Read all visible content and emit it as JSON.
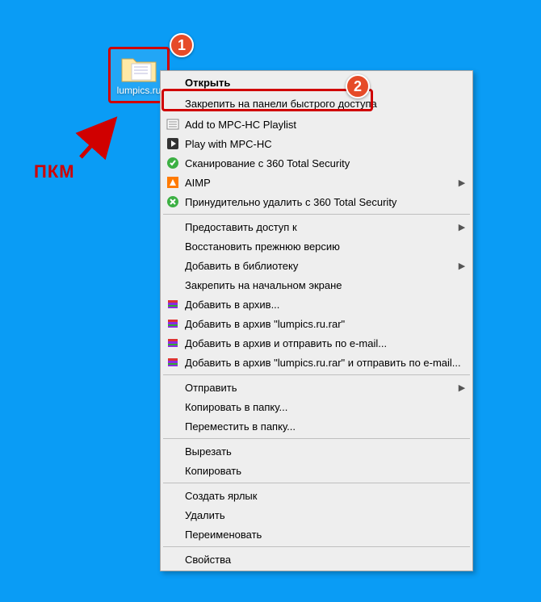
{
  "desktop": {
    "folder_label": "lumpics.ru"
  },
  "badges": {
    "one": "1",
    "two": "2"
  },
  "annotation": {
    "rmb_label": "ПКМ"
  },
  "menu": {
    "open": "Открыть",
    "pin_quick": "Закрепить на панели быстрого доступа",
    "mpc_add": "Add to MPC-HC Playlist",
    "mpc_play": "Play with MPC-HC",
    "scan_360": "Сканирование с 360 Total Security",
    "aimp": "AIMP",
    "delete_360": "Принудительно удалить с  360 Total Security",
    "give_access": "Предоставить доступ к",
    "restore_prev": "Восстановить прежнюю версию",
    "add_library": "Добавить в библиотеку",
    "pin_start": "Закрепить на начальном экране",
    "archive_add": "Добавить в архив...",
    "archive_name": "Добавить в архив \"lumpics.ru.rar\"",
    "archive_mail": "Добавить в архив и отправить по e-mail...",
    "archive_name_mail": "Добавить в архив \"lumpics.ru.rar\" и отправить по e-mail...",
    "send_to": "Отправить",
    "copy_to": "Копировать в папку...",
    "move_to": "Переместить в папку...",
    "cut": "Вырезать",
    "copy": "Копировать",
    "shortcut": "Создать ярлык",
    "delete": "Удалить",
    "rename": "Переименовать",
    "properties": "Свойства"
  }
}
